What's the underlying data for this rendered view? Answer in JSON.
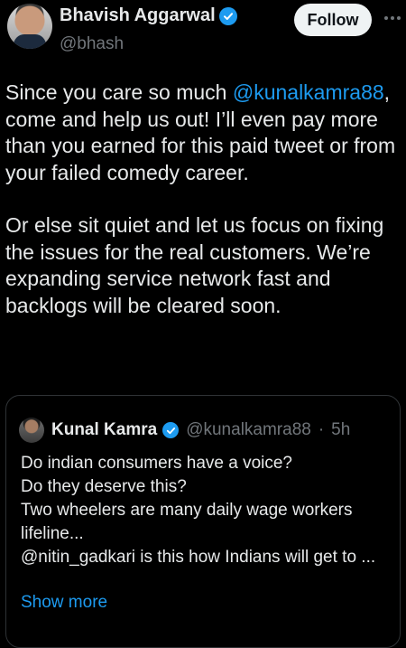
{
  "author": {
    "name": "Bhavish Aggarwal",
    "handle": "@bhash"
  },
  "actions": {
    "follow_label": "Follow"
  },
  "tweet": {
    "p1": {
      "before": "Since you care so much ",
      "mention": "@kunalkamra88",
      "after": ", come and help us out! I’ll even pay more than you earned for this paid tweet or from your failed comedy career."
    },
    "p2": "Or else sit quiet and let us focus on fixing the issues for the real customers. We’re expanding service network fast and backlogs will be cleared soon."
  },
  "quote": {
    "name": "Kunal Kamra",
    "handle": "@kunalkamra88",
    "separator": "·",
    "time": "5h",
    "lines": [
      "Do indian consumers have a voice?",
      "Do they deserve this?",
      "Two wheelers are many daily wage workers",
      "lifeline...",
      "@nitin_gadkari is this how Indians will get to ..."
    ],
    "show_more": "Show more"
  },
  "colors": {
    "background": "#000000",
    "text": "#e7e9ea",
    "muted": "#71767b",
    "accent": "#1d9bf0",
    "border": "#2f3336"
  }
}
